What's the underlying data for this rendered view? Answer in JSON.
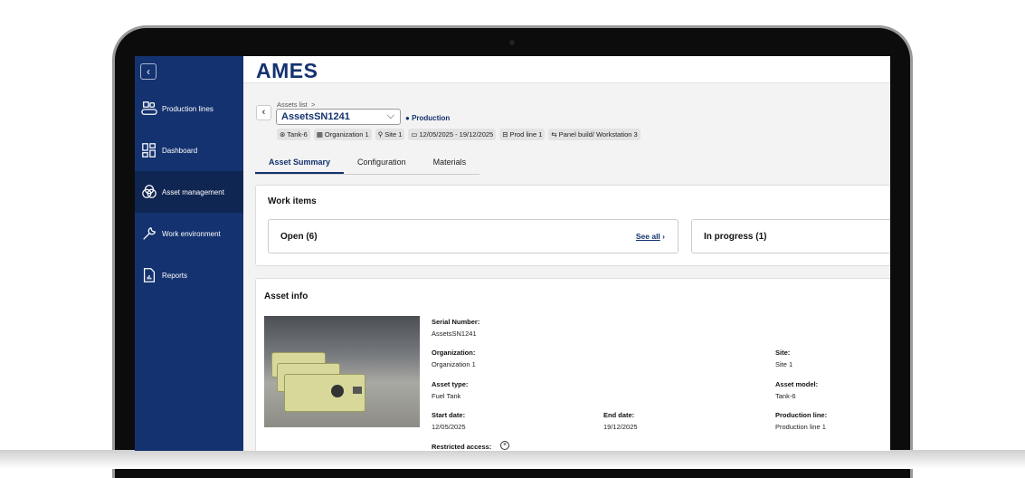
{
  "app": {
    "title": "AMES"
  },
  "sidebar": {
    "items": [
      {
        "label": "Production lines",
        "icon": "conveyor-icon"
      },
      {
        "label": "Dashboard",
        "icon": "dashboard-icon"
      },
      {
        "label": "Asset management",
        "icon": "asset-icon",
        "active": true
      },
      {
        "label": "Work environment",
        "icon": "wrench-icon"
      },
      {
        "label": "Reports",
        "icon": "report-icon"
      }
    ]
  },
  "breadcrumb": {
    "parent": "Assets list",
    "chevron": ">"
  },
  "asset": {
    "selected": "AssetsSN1241",
    "status": "Production"
  },
  "chips": [
    {
      "icon": "asset-icon",
      "label": "Tank-6"
    },
    {
      "icon": "building-icon",
      "label": "Organization 1"
    },
    {
      "icon": "location-icon",
      "label": "Site 1"
    },
    {
      "icon": "calendar-icon",
      "label": "12/05/2025 - 19/12/2025"
    },
    {
      "icon": "conveyor-icon",
      "label": "Prod line 1"
    },
    {
      "icon": "workflow-icon",
      "label": "Panel build/ Workstation 3"
    }
  ],
  "tabs": [
    {
      "label": "Asset Summary",
      "active": true
    },
    {
      "label": "Configuration"
    },
    {
      "label": "Materials"
    }
  ],
  "work_items": {
    "title": "Work items",
    "open": "Open (6)",
    "see_all": "See all",
    "in_progress": "In progress (1)"
  },
  "asset_info": {
    "title": "Asset info",
    "serial_label": "Serial Number:",
    "serial": "AssetsSN1241",
    "org_label": "Organization:",
    "org": "Organization 1",
    "site_label": "Site:",
    "site": "Site 1",
    "type_label": "Asset type:",
    "type": "Fuel Tank",
    "model_label": "Asset model:",
    "model": "Tank-6",
    "start_label": "Start date:",
    "start": "12/05/2025",
    "end_label": "End date:",
    "end": "19/12/2025",
    "line_label": "Production line:",
    "line": "Production line 1",
    "restricted_label": "Restricted access:"
  },
  "colors": {
    "brand": "#14326f",
    "sidebar_active": "#0f2552"
  }
}
